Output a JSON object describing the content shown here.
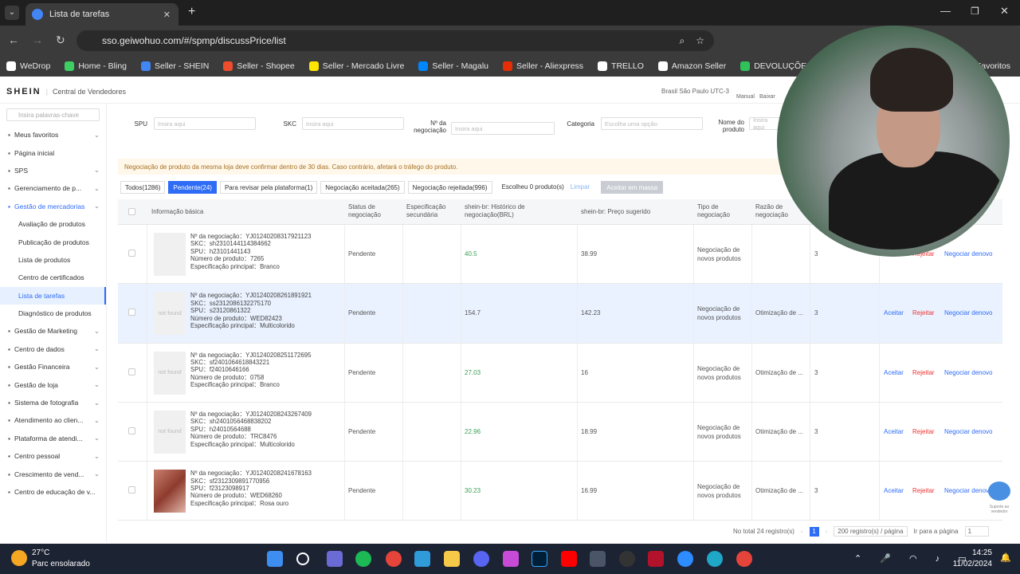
{
  "browser": {
    "tab_title": "Lista de tarefas",
    "url": "sso.geiwohuo.com/#/spmp/discussPrice/list"
  },
  "bookmarks": [
    {
      "label": "WeDrop",
      "color": "#ffffff"
    },
    {
      "label": "Home - Bling",
      "color": "#3ecf62"
    },
    {
      "label": "Seller - SHEIN",
      "color": "#4285f4"
    },
    {
      "label": "Seller - Shopee",
      "color": "#ee4d2d"
    },
    {
      "label": "Seller - Mercado Livre",
      "color": "#ffe600"
    },
    {
      "label": "Seller - Magalu",
      "color": "#0086ff"
    },
    {
      "label": "Seller - Aliexpress",
      "color": "#e62e04"
    },
    {
      "label": "TRELLO",
      "color": "#ffffff"
    },
    {
      "label": "Amazon Seller",
      "color": "#ffffff"
    },
    {
      "label": "DEVOLUÇÕES",
      "color": "#30c15a"
    }
  ],
  "bookmarks_right": "Favoritos",
  "header": {
    "logo": "SHEIN",
    "subtitle": "Central de Vendedores",
    "region": "Brasil São Paulo UTC-3",
    "actions": [
      "Manual",
      "Baixar"
    ]
  },
  "sidebar": {
    "search_placeholder": "Insira palavras-chave",
    "items": [
      {
        "label": "Meus favoritos",
        "sub": false,
        "chev": true
      },
      {
        "label": "Página inicial",
        "sub": false,
        "chev": false
      },
      {
        "label": "SPS",
        "sub": false,
        "chev": true
      },
      {
        "label": "Gerenciamento de p...",
        "sub": false,
        "chev": true
      },
      {
        "label": "Gestão de mercadorias",
        "sub": false,
        "chev": true,
        "accent": true
      },
      {
        "label": "Avaliação de produtos",
        "sub": true
      },
      {
        "label": "Publicação de produtos",
        "sub": true
      },
      {
        "label": "Lista de produtos",
        "sub": true
      },
      {
        "label": "Centro de certificados",
        "sub": true
      },
      {
        "label": "Lista de tarefas",
        "sub": true,
        "active": true
      },
      {
        "label": "Diagnóstico de produtos",
        "sub": true
      },
      {
        "label": "Gestão de Marketing",
        "sub": false,
        "chev": true
      },
      {
        "label": "Centro de dados",
        "sub": false,
        "chev": true
      },
      {
        "label": "Gestão Financeira",
        "sub": false,
        "chev": true
      },
      {
        "label": "Gestão de loja",
        "sub": false,
        "chev": true
      },
      {
        "label": "Sistema de fotografia",
        "sub": false,
        "chev": true
      },
      {
        "label": "Atendimento ao clien...",
        "sub": false,
        "chev": true
      },
      {
        "label": "Plataforma de atendi...",
        "sub": false,
        "chev": true
      },
      {
        "label": "Centro pessoal",
        "sub": false,
        "chev": true
      },
      {
        "label": "Crescimento de vend...",
        "sub": false,
        "chev": true
      },
      {
        "label": "Centro de educação de v...",
        "sub": false,
        "chev": false
      }
    ]
  },
  "filters": {
    "spu": "SPU",
    "skc": "SKC",
    "negociacao": "Nº da negociação",
    "categoria": "Categoria",
    "nome": "Nome do produto",
    "placeholder": "Insira aqui",
    "select_placeholder": "Escolha uma opção"
  },
  "notice": "Negociação de produto da mesma loja deve confirmar dentro de 30 dias. Caso contrário, afetará o tráfego do produto.",
  "tabs": [
    "Todos(1286)",
    "Pendente(24)",
    "Para revisar pela plataforma(1)",
    "Negociação aceitada(265)",
    "Negociação rejeitada(996)"
  ],
  "selected_count": "Escolheu 0 produto(s)",
  "clear": "Limpar",
  "bulk_accept": "Aceitar em massa",
  "columns": [
    "Informação básica",
    "Status de negociação",
    "Especificação secundária",
    "shein-br: Histórico de negociação(BRL)",
    "shein-br: Preço sugerido",
    "Tipo de negociação",
    "Razão de negociação"
  ],
  "rows": [
    {
      "neg": "Nº da negociação：YJ0124020831792112​3",
      "skc": "SKC：sh2310144114384662",
      "spu": "SPU：h23101441143",
      "num": "Número de produto：7265",
      "spec": "Especificação principal：Branco",
      "status": "Pendente",
      "hist": "40.5",
      "price": "38.99",
      "type": "Negociação de novos produtos",
      "reason": "",
      "count": "3",
      "thumb": "img",
      "accept": "",
      "reject": "Rejeitar",
      "again": "Negociar denovo"
    },
    {
      "neg": "Nº da negociação：YJ0124020826189192​1",
      "skc": "SKC：ss2312086132275170",
      "spu": "SPU：s2312086132​2",
      "num": "Número de produto：WED82423",
      "spec": "Especificação principal：Multicolorido",
      "status": "Pendente",
      "hist": "154.7",
      "price": "142.23",
      "type": "Negociação de novos produtos",
      "reason": "Otimização de ...",
      "count": "3",
      "thumb": "not found",
      "accept": "Aceitar",
      "reject": "Rejeitar",
      "again": "Negociar denovo"
    },
    {
      "neg": "Nº da negociação：YJ0124020825117269​5",
      "skc": "SKC：sf2401064618843221",
      "spu": "SPU：f24010646166",
      "num": "Número de produto：0758",
      "spec": "Especificação principal：Branco",
      "status": "Pendente",
      "hist": "27.03",
      "price": "16",
      "type": "Negociação de novos produtos",
      "reason": "Otimização de ...",
      "count": "3",
      "thumb": "not found",
      "accept": "Aceitar",
      "reject": "Rejeitar",
      "again": "Negociar denovo"
    },
    {
      "neg": "Nº da negociação：YJ0124020824326740​9",
      "skc": "SKC：sh2401056468838202",
      "spu": "SPU：h24010564688",
      "num": "Número de produto：TRC8476",
      "spec": "Especificação principal：Multicolorido",
      "status": "Pendente",
      "hist": "22.96",
      "price": "18.99",
      "type": "Negociação de novos produtos",
      "reason": "Otimização de ...",
      "count": "3",
      "thumb": "not found",
      "accept": "Aceitar",
      "reject": "Rejeitar",
      "again": "Negociar denovo"
    },
    {
      "neg": "Nº da negociação：YJ0124020824167816​3",
      "skc": "SKC：sf2312309891770956",
      "spu": "SPU：f23123098917",
      "num": "Número de produto：WED68260",
      "spec": "Especificação principal：Rosa ouro",
      "status": "Pendente",
      "hist": "30.23",
      "price": "16.99",
      "type": "Negociação de novos produtos",
      "reason": "Otimização de ...",
      "count": "3",
      "thumb": "img2",
      "accept": "Aceitar",
      "reject": "Rejeitar",
      "again": "Negociar denovo"
    }
  ],
  "pager": {
    "total": "No total 24 registro(s)",
    "page": "1",
    "per_page": "200 registro(s) / página",
    "goto": "Ir para a página",
    "goto_val": "1"
  },
  "support": "Suporte ao vendedor",
  "taskbar": {
    "temp": "27°C",
    "weather": "Parc ensolarado",
    "time": "14:25",
    "date": "11/02/2024"
  }
}
